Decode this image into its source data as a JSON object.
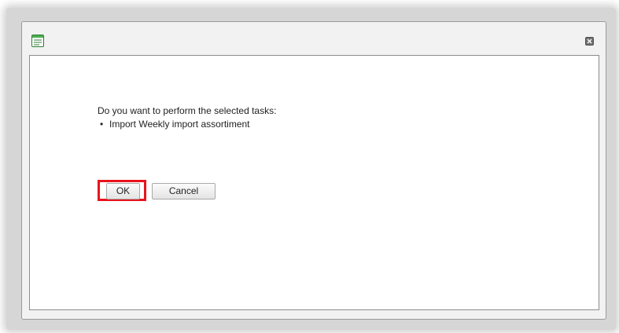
{
  "dialog": {
    "app_icon": "document-icon",
    "close_icon": "close-icon",
    "message": "Do you want to perform the selected tasks:",
    "tasks": [
      "Import Weekly import assortiment"
    ],
    "bullet": "•",
    "ok_label": "OK",
    "cancel_label": "Cancel",
    "highlight_color": "#e8141c"
  }
}
